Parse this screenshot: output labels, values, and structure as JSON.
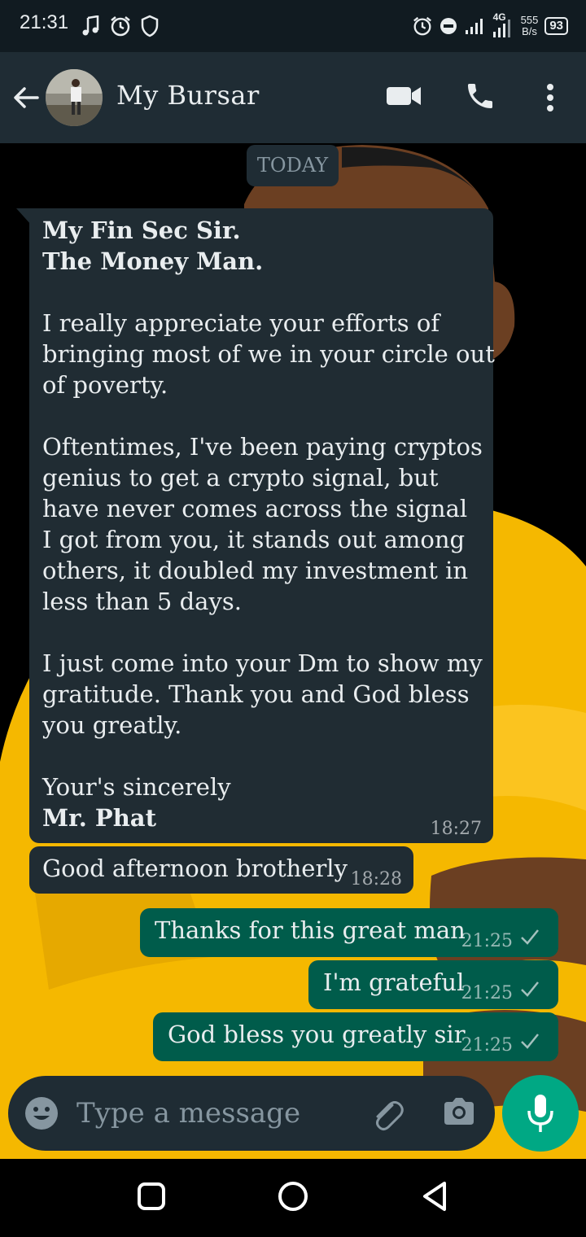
{
  "status_bar": {
    "time": "21:31",
    "net_speed_value": "555",
    "net_speed_unit": "B/s",
    "network_label": "4G",
    "battery": "93"
  },
  "header": {
    "contact_name": "My Bursar"
  },
  "chat": {
    "date_label": "TODAY",
    "messages": [
      {
        "direction": "incoming",
        "lines": [
          {
            "text": "My Fin Sec Sir.",
            "bold": true
          },
          {
            "text": "The Money Man.",
            "bold": true
          },
          {
            "text": ""
          },
          {
            "text": "I really appreciate your efforts of"
          },
          {
            "text": "bringing most of we in your circle out"
          },
          {
            "text": "of poverty."
          },
          {
            "text": ""
          },
          {
            "text": "Oftentimes, I've been paying cryptos"
          },
          {
            "text": "genius to get a crypto signal, but"
          },
          {
            "text": "have never comes across the signal"
          },
          {
            "text": "I got from you, it stands out among"
          },
          {
            "text": "others, it doubled my investment in"
          },
          {
            "text": "less than 5 days."
          },
          {
            "text": ""
          },
          {
            "text": "I just come into your Dm to show my"
          },
          {
            "text": "gratitude. Thank you and God bless"
          },
          {
            "text": "you greatly."
          },
          {
            "text": ""
          },
          {
            "text": "Your's sincerely"
          },
          {
            "text": "Mr. Phat",
            "bold": true
          }
        ],
        "time": "18:27"
      },
      {
        "direction": "incoming",
        "text": "Good afternoon brotherly",
        "time": "18:28"
      },
      {
        "direction": "outgoing",
        "text": "Thanks for this great man",
        "time": "21:25",
        "status": "sent"
      },
      {
        "direction": "outgoing",
        "text": "I'm grateful",
        "time": "21:25",
        "status": "sent"
      },
      {
        "direction": "outgoing",
        "text": "God bless you greatly sir",
        "time": "21:25",
        "status": "sent"
      }
    ]
  },
  "input_bar": {
    "placeholder": "Type a message"
  },
  "icons": {
    "status_left": [
      "music-note-icon",
      "alarm-icon",
      "shield-icon"
    ],
    "status_right": [
      "alarm-icon",
      "do-not-disturb-icon",
      "signal-icon",
      "network-4g-icon",
      "net-speed",
      "battery-icon"
    ],
    "header": [
      "back-arrow-icon",
      "avatar",
      "video-call-icon",
      "phone-icon",
      "more-options-icon"
    ],
    "input": [
      "emoji-icon",
      "attach-icon",
      "camera-icon",
      "mic-icon"
    ],
    "nav": [
      "recents-icon",
      "home-icon",
      "back-icon"
    ]
  },
  "colors": {
    "header_bg": "#1f2c34",
    "incoming_bubble": "#202c33",
    "outgoing_bubble": "#005c4b",
    "accent": "#00a884",
    "wallpaper_shirt": "#f5b800"
  }
}
